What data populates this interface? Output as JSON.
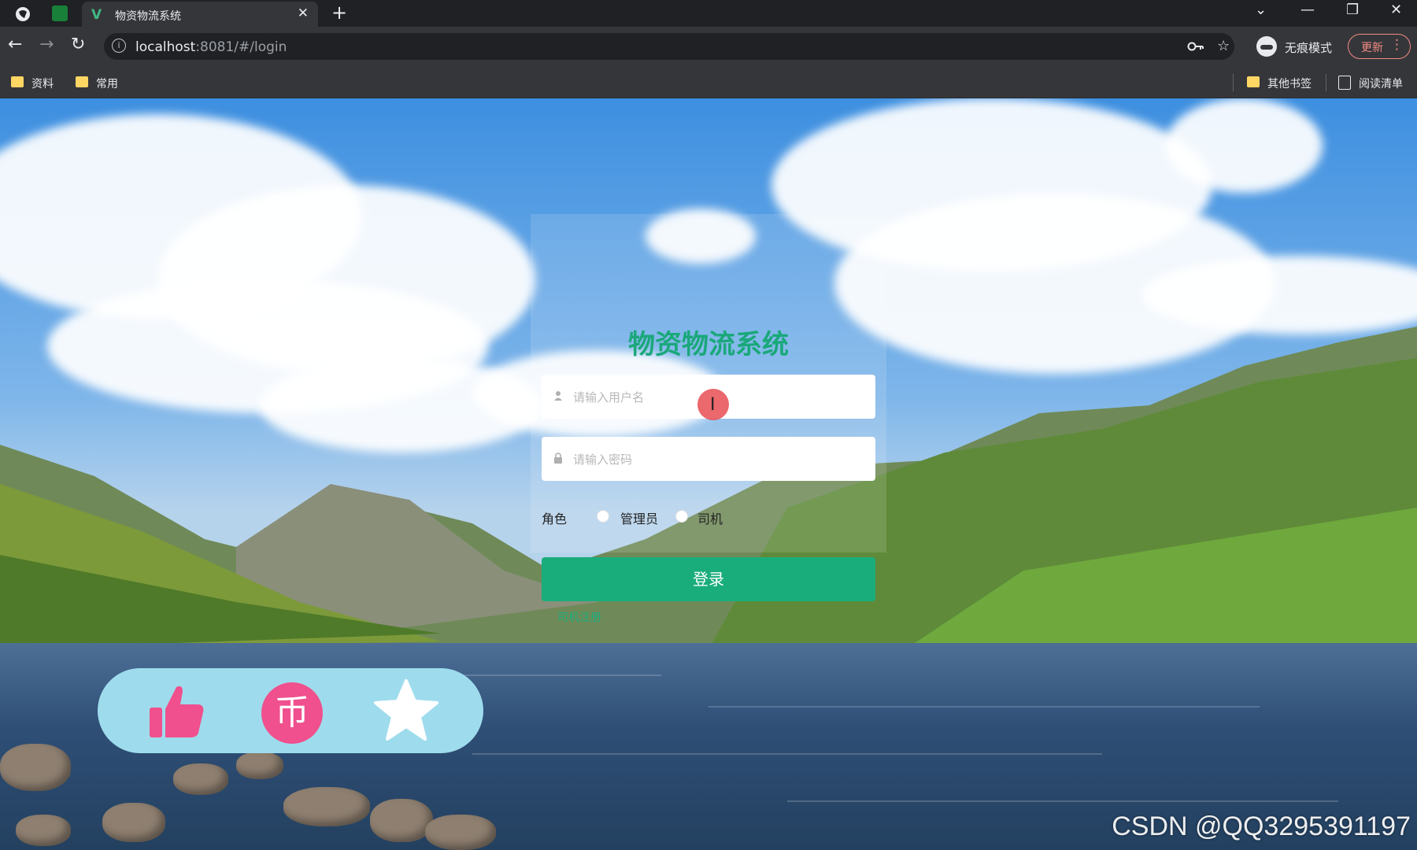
{
  "browser": {
    "tab_title": "物资物流系统",
    "tab_favicon": "V",
    "tab_close": "✕",
    "new_tab": "+",
    "window_controls": [
      "⌄",
      "—",
      "❐",
      "✕"
    ],
    "url_host": "localhost",
    "url_path": ":8081/#/login",
    "incognito_label": "无痕模式",
    "update_label": "更新",
    "update_menu": "⋮",
    "key_icon": "key-icon",
    "star_icon": "star-icon"
  },
  "bookmarks": {
    "left": [
      "资料",
      "常用"
    ],
    "other": "其他书签",
    "reading_list": "阅读清单"
  },
  "login": {
    "title": "物资物流系统",
    "username_placeholder": "请输入用户名",
    "password_placeholder": "请输入密码",
    "role_label": "角色",
    "roles": [
      "管理员",
      "司机"
    ],
    "login_button": "登录",
    "register_link": "司机注册"
  },
  "overlay": {
    "icons": [
      "thumbs-up-icon",
      "coin-icon",
      "star-icon"
    ],
    "coin_char": "币",
    "colors": {
      "bar": "#9edced",
      "accent": "#f0508d"
    }
  },
  "watermark": "CSDN @QQ3295391197",
  "colors": {
    "brand_green": "#1aad7c"
  }
}
